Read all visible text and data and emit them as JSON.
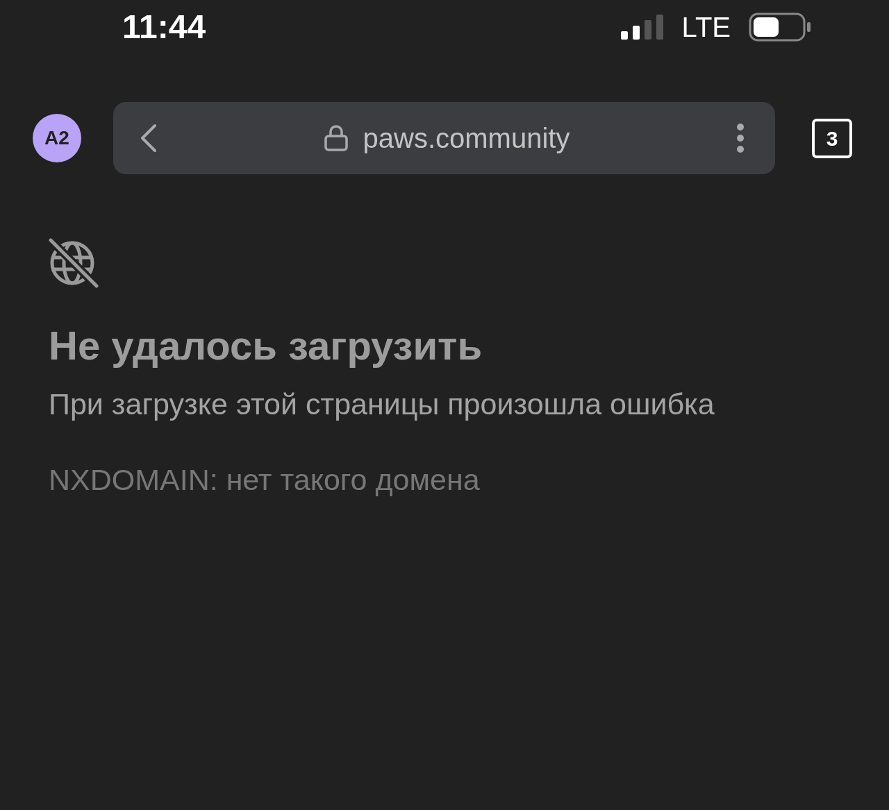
{
  "status_bar": {
    "time": "11:44",
    "network": "LTE"
  },
  "browser_bar": {
    "profile": "A2",
    "url": "paws.community",
    "tab_count": "3"
  },
  "error": {
    "title": "Не удалось загрузить",
    "message": "При загрузке этой страницы произошла ошибка",
    "code": "NXDOMAIN: нет такого домена"
  }
}
